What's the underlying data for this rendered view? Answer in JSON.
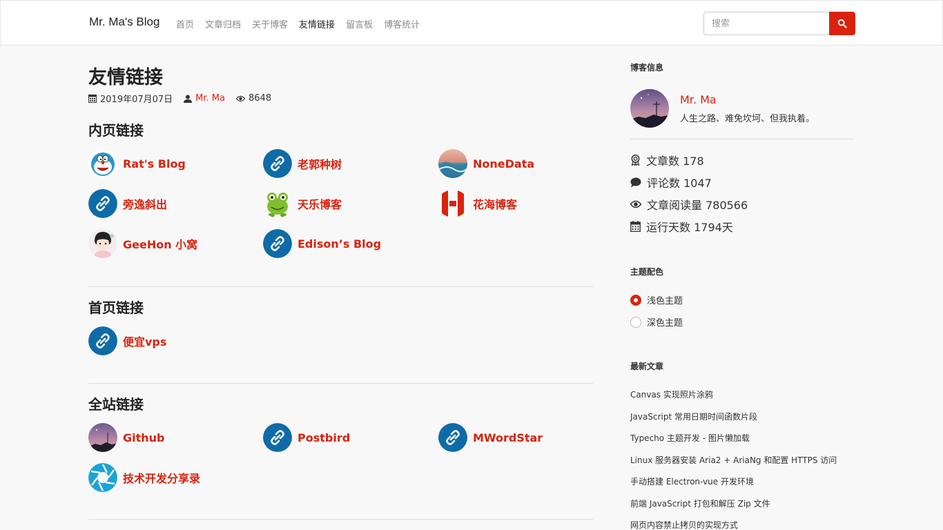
{
  "header": {
    "brand": "Mr. Ma's Blog",
    "nav": [
      "首页",
      "文章归档",
      "关于博客",
      "友情链接",
      "留言板",
      "博客统计"
    ],
    "active_nav": "友情链接",
    "search_placeholder": "搜索",
    "accent": "#d9230f"
  },
  "page": {
    "title": "友情链接",
    "date": "2019年07月07日",
    "author": "Mr. Ma",
    "views": "8648"
  },
  "sections": [
    {
      "title": "内页链接",
      "links": [
        {
          "name": "Rat's Blog",
          "icon": "doraemon-avatar-icon"
        },
        {
          "name": "老郭种树",
          "icon": "link-icon"
        },
        {
          "name": "NoneData",
          "icon": "wave-painting-avatar-icon"
        },
        {
          "name": "旁逸斜出",
          "icon": "link-icon"
        },
        {
          "name": "天乐博客",
          "icon": "frog-avatar-icon"
        },
        {
          "name": "花海博客",
          "icon": "red-h-logo-icon"
        },
        {
          "name": "GeeHon 小窝",
          "icon": "anime-boy-avatar-icon"
        },
        {
          "name": "Edison’s Blog",
          "icon": "link-icon"
        }
      ]
    },
    {
      "title": "首页链接",
      "links": [
        {
          "name": "便宜vps",
          "icon": "link-icon"
        }
      ]
    },
    {
      "title": "全站链接",
      "links": [
        {
          "name": "Github",
          "icon": "night-sky-avatar-icon"
        },
        {
          "name": "Postbird",
          "icon": "link-icon"
        },
        {
          "name": "MWordStar",
          "icon": "link-icon"
        },
        {
          "name": "技术开发分享录",
          "icon": "aperture-logo-icon"
        }
      ]
    }
  ],
  "sidebar": {
    "info_title": "博客信息",
    "profile_name": "Mr. Ma",
    "profile_bio": "人生之路、难免坎坷、但我执着。",
    "stats": [
      {
        "label": "文章数 178",
        "icon": "award-icon"
      },
      {
        "label": "评论数 1047",
        "icon": "comment-icon"
      },
      {
        "label": "文章阅读量 780566",
        "icon": "eye-icon"
      },
      {
        "label": "运行天数 1794天",
        "icon": "calendar-icon"
      }
    ],
    "theme_title": "主题配色",
    "themes": [
      {
        "label": "浅色主题",
        "checked": true
      },
      {
        "label": "深色主题",
        "checked": false
      }
    ],
    "recent_title": "最新文章",
    "recent": [
      "Canvas 实现照片涂鸦",
      "JavaScript 常用日期时间函数片段",
      "Typecho 主题开发 - 图片懒加载",
      "Linux 服务器安装 Aria2 + AriaNg 和配置 HTTPS 访问",
      "手动搭建 Electron-vue 开发环境",
      "前端 JavaScript 打包和解压 Zip 文件",
      "网页内容禁止拷贝的实现方式"
    ]
  }
}
